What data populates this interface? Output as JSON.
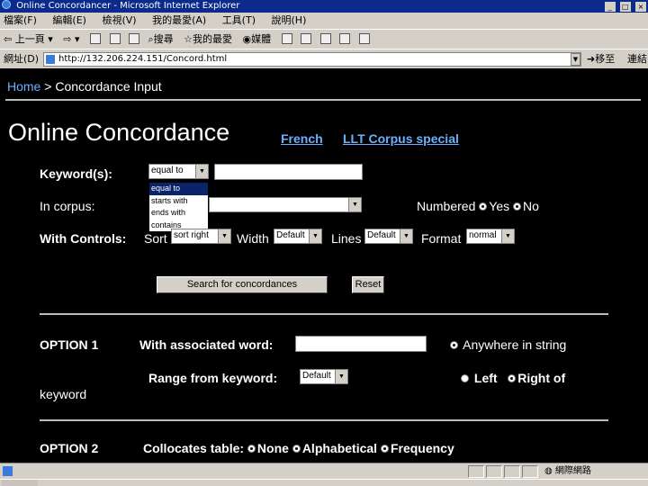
{
  "window": {
    "title": "Online Concordancer - Microsoft Internet Explorer"
  },
  "menubar": {
    "items": [
      "檔案(F)",
      "編輯(E)",
      "檢視(V)",
      "我的最愛(A)",
      "工具(T)",
      "說明(H)"
    ]
  },
  "toolbar": {
    "back_label": "上一頁",
    "search_label": "搜尋",
    "favorites_label": "我的最愛",
    "media_label": "媒體"
  },
  "addressbar": {
    "label": "網址(D)",
    "url": "http://132.206.224.151/Concord.html",
    "go_label": "移至",
    "links_label": "連結"
  },
  "page": {
    "breadcrumb_home": "Home",
    "breadcrumb_sep": ">",
    "breadcrumb_current": "Concordance Input",
    "title": "Online Concordance",
    "link_french": "French",
    "link_llt": "LLT Corpus special",
    "keyword_label": "Keyword(s):",
    "keyword_select_value": "equal to",
    "keyword_options": [
      "equal to",
      "starts with",
      "ends with",
      "contains"
    ],
    "corpus_label": "In corpus:",
    "numbered_label": "Numbered",
    "numbered_yes": "Yes",
    "numbered_no": "No",
    "controls_label": "With Controls:",
    "sort_label": "Sort",
    "sort_value": "sort right",
    "width_label": "Width",
    "width_value": "Default",
    "lines_label": "Lines",
    "lines_value": "Default",
    "format_label": "Format",
    "format_value": "normal",
    "search_button": "Search for concordances",
    "reset_button": "Reset",
    "option1_label": "OPTION 1",
    "assoc_word_label": "With associated word:",
    "anywhere_label": "Anywhere in string",
    "range_label": "Range from keyword:",
    "range_value": "Default",
    "left_label": "Left",
    "right_of_label": "Right of",
    "keyword_word": "keyword",
    "option2_label": "OPTION 2",
    "collocates_label": "Collocates table:",
    "coll_none": "None",
    "coll_alpha": "Alphabetical",
    "coll_freq": "Frequency"
  },
  "statusbar": {
    "zone": "網際網路"
  }
}
